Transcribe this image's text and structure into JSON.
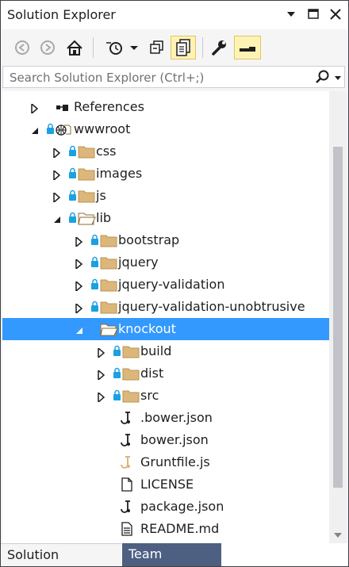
{
  "window": {
    "title": "Solution Explorer"
  },
  "titlebar_icons": [
    "dropdown-arrow-icon",
    "maximize-icon",
    "close-icon"
  ],
  "toolbar": {
    "buttons": [
      "back-icon",
      "forward-icon",
      "home-icon",
      "pending-changes-icon",
      "dropdown-icon",
      "collapse-all-icon",
      "show-all-files-icon",
      "properties-wrench-icon",
      "preview-icon"
    ],
    "active": [
      "show-all-files",
      "preview"
    ]
  },
  "search": {
    "placeholder": "Search Solution Explorer (Ctrl+;)",
    "value": ""
  },
  "tree": {
    "items": [
      {
        "label": "References",
        "icon": "references-icon",
        "expander": "collapsed",
        "level": 1
      },
      {
        "label": "wwwroot",
        "icon": "globe-folder-icon",
        "expander": "expanded",
        "level": 1
      },
      {
        "label": "css",
        "icon": "folder-icon",
        "expander": "collapsed",
        "level": 2
      },
      {
        "label": "images",
        "icon": "folder-icon",
        "expander": "collapsed",
        "level": 2
      },
      {
        "label": "js",
        "icon": "folder-icon",
        "expander": "collapsed",
        "level": 2
      },
      {
        "label": "lib",
        "icon": "open-folder-icon",
        "expander": "expanded",
        "level": 2
      },
      {
        "label": "bootstrap",
        "icon": "folder-icon",
        "expander": "collapsed",
        "level": 3
      },
      {
        "label": "jquery",
        "icon": "folder-icon",
        "expander": "collapsed",
        "level": 3
      },
      {
        "label": "jquery-validation",
        "icon": "folder-icon",
        "expander": "collapsed",
        "level": 3
      },
      {
        "label": "jquery-validation-unobtrusive",
        "icon": "folder-icon",
        "expander": "collapsed",
        "level": 3
      },
      {
        "label": "knockout",
        "icon": "open-folder-icon",
        "expander": "expanded",
        "level": 3,
        "selected": true
      },
      {
        "label": "build",
        "icon": "folder-icon",
        "expander": "collapsed",
        "level": 4
      },
      {
        "label": "dist",
        "icon": "folder-icon",
        "expander": "collapsed",
        "level": 4
      },
      {
        "label": "src",
        "icon": "folder-icon",
        "expander": "collapsed",
        "level": 4
      },
      {
        "label": ".bower.json",
        "icon": "json-file-icon",
        "level": 4
      },
      {
        "label": "bower.json",
        "icon": "json-file-icon",
        "level": 4
      },
      {
        "label": "Gruntfile.js",
        "icon": "js-file-icon",
        "level": 4
      },
      {
        "label": "LICENSE",
        "icon": "text-file-icon",
        "level": 4
      },
      {
        "label": "package.json",
        "icon": "json-file-icon",
        "level": 4
      },
      {
        "label": "README.md",
        "icon": "markdown-file-icon",
        "level": 4
      }
    ]
  },
  "tabs": [
    {
      "label": "Solution Explorer",
      "active": true
    },
    {
      "label": "Team Explorer",
      "active": false
    }
  ],
  "colors": {
    "selection": "#3399ff",
    "folder": "#dcb67a",
    "lock": "#1ba1e2",
    "inactive_tab": "#4d6082"
  }
}
